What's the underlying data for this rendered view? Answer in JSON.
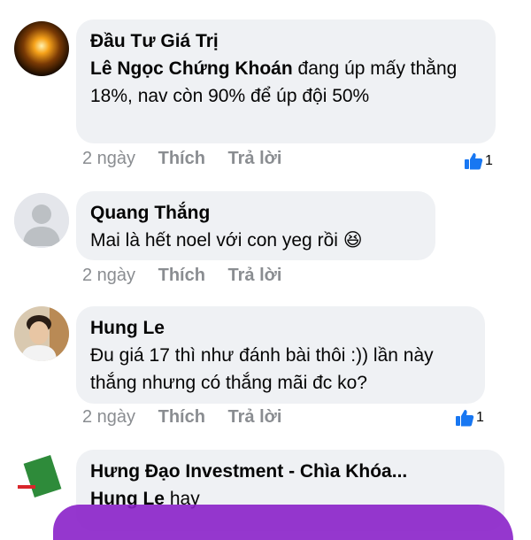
{
  "comments": [
    {
      "author": "Đầu Tư Giá Trị",
      "tag": "Lê Ngọc Chứng Khoán",
      "text": " đang úp mấy thằng 18%,  nav còn 90% để úp đội 50%",
      "time": "2 ngày",
      "like_label": "Thích",
      "reply_label": "Trả lời",
      "likes": "1"
    },
    {
      "author": "Quang Thắng",
      "text": "Mai là hết noel với con yeg rồi",
      "emoji": "😆",
      "time": "2 ngày",
      "like_label": "Thích",
      "reply_label": "Trả lời"
    },
    {
      "author": "Hung Le",
      "text": "Đu giá 17 thì như đánh bài thôi :)) lần này thắng nhưng có thắng mãi đc ko?",
      "time": "2 ngày",
      "like_label": "Thích",
      "reply_label": "Trả lời",
      "likes": "1"
    },
    {
      "author": "Hưng Đạo Investment - Chìa Khóa...",
      "tag": "Hung Le",
      "text": " hay"
    }
  ],
  "colors": {
    "bubble": "#eff1f4",
    "meta_text": "#8a8d91",
    "like_blue": "#1877f2",
    "scribble": "#8a21c9"
  },
  "icons": {
    "like": "thumbs-up-icon"
  }
}
